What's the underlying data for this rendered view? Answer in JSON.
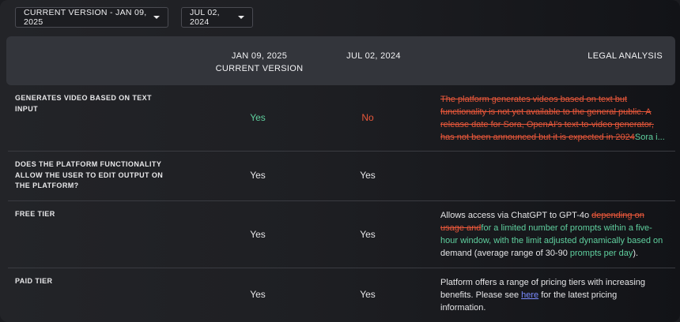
{
  "filters": {
    "current_version": "CURRENT VERSION - JAN 09, 2025",
    "compare_version": "JUL 02, 2024"
  },
  "header": {
    "col1_line1": "JAN 09, 2025",
    "col1_line2": "CURRENT VERSION",
    "col2": "JUL 02, 2024",
    "col3": "LEGAL ANALYSIS"
  },
  "rows": [
    {
      "label": "GENERATES VIDEO BASED ON TEXT INPUT",
      "v1": "Yes",
      "v2": "No",
      "legal_lines": [
        "The platform generates videos based on text but",
        "functionality is not yet available to the general public. A",
        "release date for Sora, OpenAI's text-to-video generator,",
        "has not been announced but it is expected in 2024"
      ],
      "legal_insert": "Sora i..."
    },
    {
      "label": "DOES THE PLATFORM FUNCTIONALITY ALLOW THE USER TO EDIT OUTPUT ON THE PLATFORM?",
      "v1": "Yes",
      "v2": "Yes"
    },
    {
      "label": "FREE TIER",
      "v1": "Yes",
      "v2": "Yes",
      "legal": {
        "t1": "Allows access via ChatGPT to GPT-4o ",
        "del1": "depending on usage and",
        "ins1": "for a limited number of prompts within a five-hour window, with the limit adjusted dynamically based on",
        "t2": " demand (average range of 30-90 ",
        "ins2": "prompts per day",
        "t3": ")."
      }
    },
    {
      "label": "PAID TIER",
      "v1": "Yes",
      "v2": "Yes",
      "legal": {
        "t1": "Platform offers a range of pricing tiers with increasing benefits. Please see ",
        "link": "here",
        "t2": " for the latest pricing information."
      }
    }
  ],
  "colors": {
    "yes_green": "#5fcf9e",
    "no_red": "#e8573a",
    "deleted": "#e8573a",
    "inserted": "#5fcf9e",
    "link": "#7b8cff"
  }
}
